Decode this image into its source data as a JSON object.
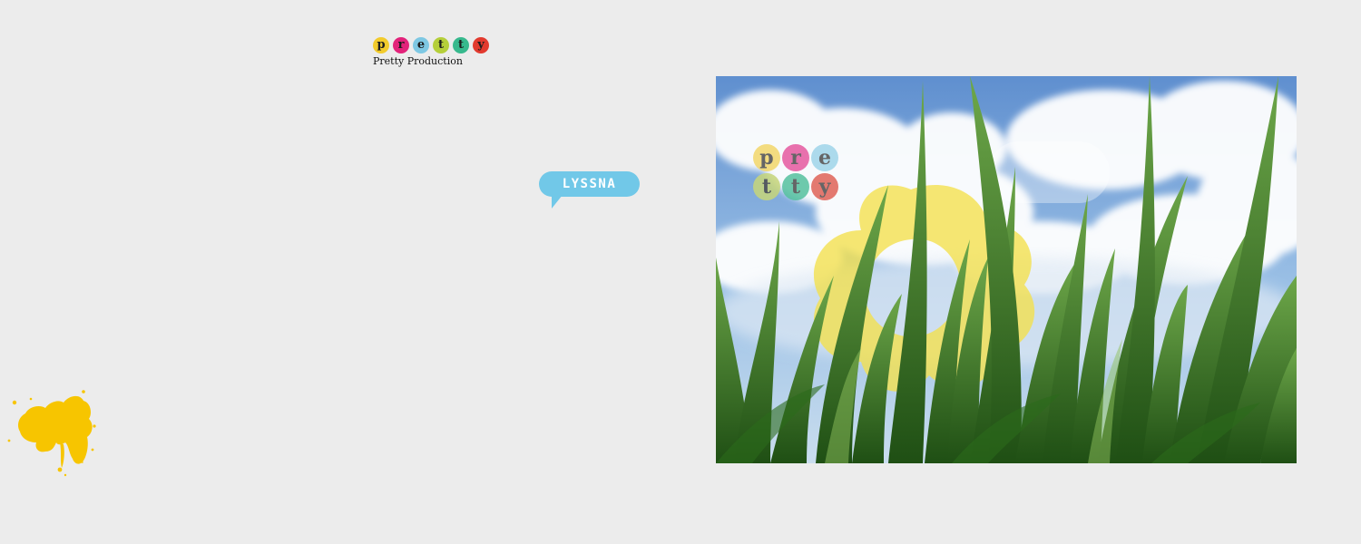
{
  "logo": {
    "letters": [
      {
        "char": "p",
        "color": "#f2cb2c"
      },
      {
        "char": "r",
        "color": "#e2227a"
      },
      {
        "char": "e",
        "color": "#7ec8e3"
      },
      {
        "char": "t",
        "color": "#b5cf3a"
      },
      {
        "char": "t",
        "color": "#37b98d"
      },
      {
        "char": "y",
        "color": "#e23a2e"
      }
    ],
    "caption": "Pretty Production"
  },
  "bubble": {
    "label": "LYSSNA",
    "color": "#71c8e8"
  },
  "splat": {
    "icon": "yellow-paint-splat",
    "color": "#f7c500"
  },
  "hero": {
    "description_icon": "grass-and-sky-photo",
    "overlay_letters": [
      {
        "char": "p",
        "color": "#f3d76b"
      },
      {
        "char": "r",
        "color": "#e65aa0"
      },
      {
        "char": "e",
        "color": "#9fd5ea"
      },
      {
        "char": "t",
        "color": "#c7d67a"
      },
      {
        "char": "t",
        "color": "#55c19f"
      },
      {
        "char": "y",
        "color": "#e06358"
      }
    ],
    "flower_color": "#f3e04a"
  }
}
